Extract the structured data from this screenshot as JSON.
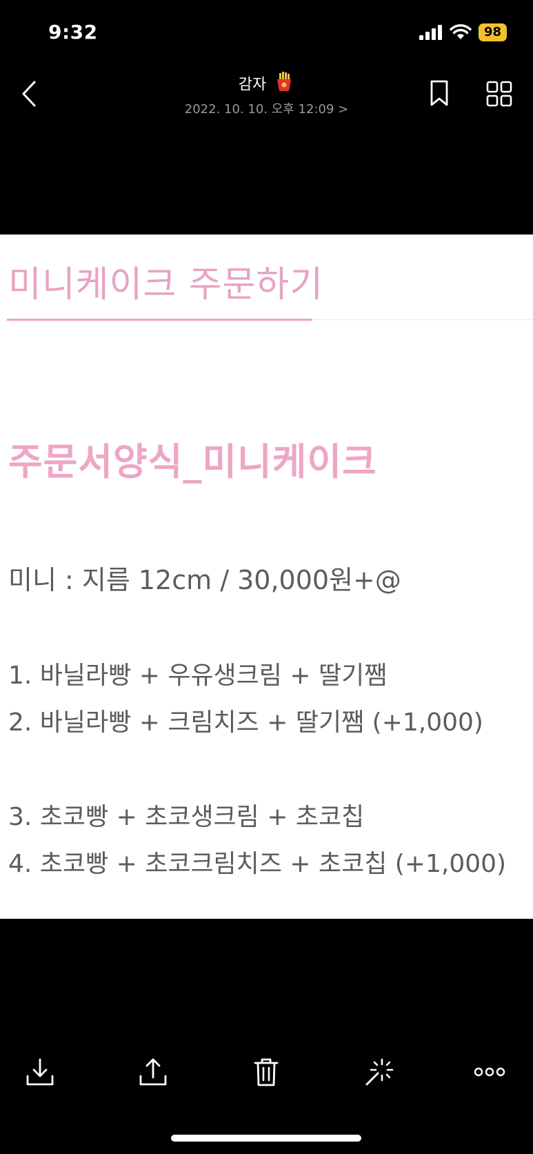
{
  "status_bar": {
    "time": "9:32",
    "battery": "98"
  },
  "nav": {
    "title": "감자",
    "title_emoji_icon": "french-fries-icon",
    "subtitle": "2022. 10. 10. 오후 12:09 >"
  },
  "photo": {
    "heading": "미니케이크 주문하기",
    "form_title": "주문서양식_미니케이크",
    "size_line": "미니 : 지름 12cm / 30,000원+@",
    "options": [
      "1. 바닐라빵 + 우유생크림 + 딸기쨈",
      "2. 바닐라빵 + 크림치즈 + 딸기쨈 (+1,000)",
      "3. 초코빵 + 초코생크림 + 초코칩",
      "4. 초코빵 + 초코크림치즈 + 초코칩 (+1,000)"
    ],
    "colors": {
      "accent_pink": "#e7a3c3",
      "body_text": "#5c5c5c"
    }
  },
  "toolbar": {
    "icons": [
      "download-icon",
      "share-icon",
      "trash-icon",
      "magic-wand-icon",
      "more-icon"
    ]
  }
}
